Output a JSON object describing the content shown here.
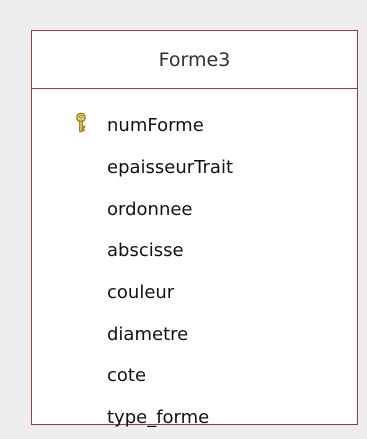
{
  "table": {
    "name": "Forme3",
    "border_color": "#a23a3a",
    "primary_key_icon": "key-icon",
    "fields": [
      {
        "name": "numForme",
        "primary_key": true
      },
      {
        "name": "epaisseurTrait",
        "primary_key": false
      },
      {
        "name": "ordonnee",
        "primary_key": false
      },
      {
        "name": "abscisse",
        "primary_key": false
      },
      {
        "name": "couleur",
        "primary_key": false
      },
      {
        "name": "diametre",
        "primary_key": false
      },
      {
        "name": "cote",
        "primary_key": false
      },
      {
        "name": "type_forme",
        "primary_key": false
      }
    ]
  }
}
